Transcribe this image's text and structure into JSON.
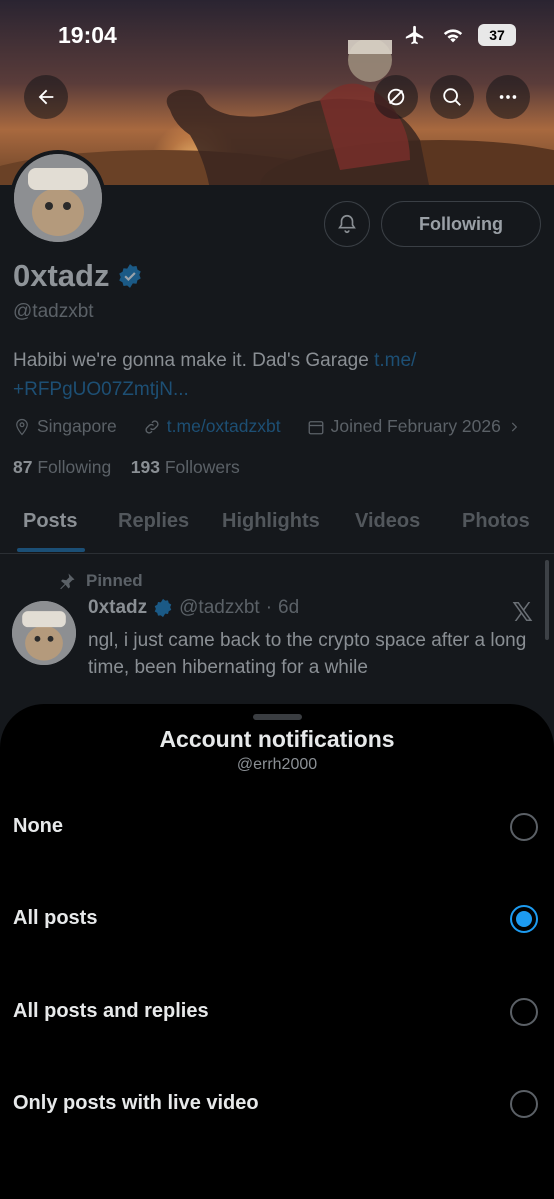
{
  "status_bar": {
    "time": "19:04",
    "battery": "37"
  },
  "profile": {
    "name": "0xtadz",
    "handle": "@tadzxbt",
    "bio_text": "Habibi we're gonna make it. Dad's Garage ",
    "bio_link": "t.me/\n+RFPgUO07ZmtjN...",
    "location": "Singapore",
    "website": "t.me/oxtadzxbt",
    "joined": "Joined February 2026",
    "following_count": "87",
    "following_label": "Following",
    "followers_count": "193",
    "followers_label": "Followers",
    "following_button": "Following"
  },
  "tabs": [
    "Posts",
    "Replies",
    "Highlights",
    "Videos",
    "Photos"
  ],
  "post": {
    "pinned_label": "Pinned",
    "author_name": "0xtadz",
    "author_handle": "@tadzxbt",
    "time": "6d",
    "separator": "·",
    "text": "ngl, i just came back to the crypto space after a long time, been hibernating for a while"
  },
  "sheet": {
    "title": "Account notifications",
    "subtitle": "@errh2000",
    "options": [
      {
        "label": "None",
        "selected": false
      },
      {
        "label": "All posts",
        "selected": true
      },
      {
        "label": "All posts and replies",
        "selected": false
      },
      {
        "label": "Only posts with live video",
        "selected": false
      }
    ]
  },
  "colors": {
    "accent": "#1d9bf0",
    "sheet_bg": "#000000",
    "profile_bg": "#15181c"
  },
  "icons": [
    "back-arrow-icon",
    "hide-icon",
    "search-icon",
    "more-icon",
    "bell-plus-icon",
    "verified-icon",
    "location-icon",
    "link-icon",
    "calendar-icon",
    "chevron-right-icon",
    "pin-icon",
    "x-logo-icon",
    "airplane-icon",
    "wifi-icon",
    "battery-icon"
  ]
}
